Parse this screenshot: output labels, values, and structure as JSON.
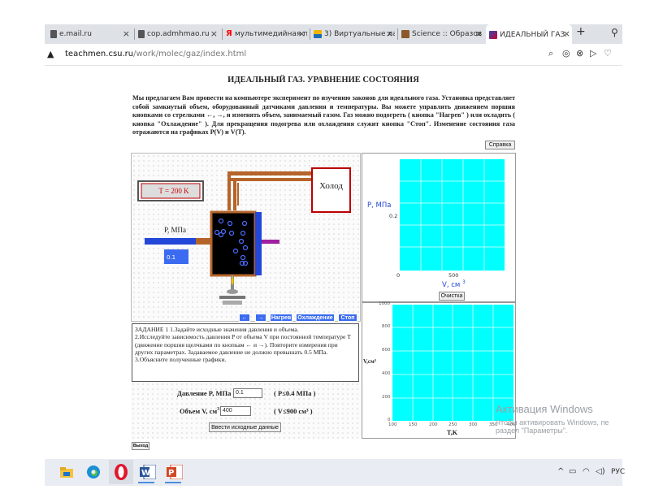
{
  "browser": {
    "tabs": [
      {
        "label": "e.mail.ru",
        "icon": "page-icon"
      },
      {
        "label": "cop.admhmao.ru",
        "icon": "page-icon"
      },
      {
        "label": "мультимедийная п",
        "icon": "yandex-icon"
      },
      {
        "label": "3) Виртуальные ла",
        "icon": "image-icon"
      },
      {
        "label": "Science :: Образов",
        "icon": "science-icon"
      },
      {
        "label": "ИДЕАЛЬНЫЙ ГАЗ.",
        "icon": "lab-icon",
        "active": true
      }
    ],
    "new_tab": "+",
    "close": "×",
    "url_host": "teachmen.csu.ru",
    "url_path": "/work/molec/gaz/index.html"
  },
  "page": {
    "title": "ИДЕАЛЬНЫЙ ГАЗ. УРАВНЕНИЕ СОСТОЯНИЯ",
    "intro": "Мы предлагаем Вам провести на компьютере эксперимент по изучению законов для идеального газа. Установка представляет собой замкнутый объем, оборудованный датчиками давления и температуры. Вы можете управлять движением поршня кнопками со стрелками ←, →, и изменять объем, занимаемый газом. Газ можно подогреть ( кнопка \"Нагрев\" ) или охладить ( кнопка \"Охлаждение\" ). Для прекращения подогрева или охлаждения служит кнопка \"Стоп\". Изменение состояния газа отражаются на графиках P(V) и V(T).",
    "help_button": "Справка"
  },
  "simulation": {
    "temperature": "T = 200 K",
    "cold_label": "Холод",
    "pressure_label": "P, МПа",
    "pressure_value": "0.1",
    "buttons": {
      "left": "←",
      "right": "→",
      "heat": "Нагрев",
      "cool": "Охлаждение",
      "stop": "Стоп"
    }
  },
  "graph_pv": {
    "ylabel": "P, МПа",
    "ytick": "0.2",
    "xtick0": "0",
    "xtick1": "500",
    "xlabel": "V, см",
    "xlabel_sup": "3",
    "clear_button": "Очистка",
    "bg_color": "#00ffff"
  },
  "graph_vt": {
    "ylabel": "V,см³",
    "yticks": [
      "1000",
      "800",
      "600",
      "400",
      "200",
      "0"
    ],
    "xticks": [
      "100",
      "150",
      "200",
      "250",
      "300",
      "350",
      "400"
    ],
    "xlabel": "T,K",
    "bg_color": "#00ffff"
  },
  "task": {
    "text": "ЗАДАНИЕ 1 1.Задайте исходные значения давления и объема.\n2.Исследуйте зависимость давления P от объема V при постоянной температуре T (движение поршня щелчками по кнопкам ← и →). Повторите измерения при других параметрах. Задаваемое давление не должно превышать 0.5 МПа.\n3.Объясните полученные графики."
  },
  "form": {
    "pressure_label": "Давление P, МПа",
    "pressure_value": "0.1",
    "pressure_hint": "( P≤0.4 МПа )",
    "volume_label": "Объем V, см",
    "volume_sup": "3",
    "volume_value": "400",
    "volume_hint": "( V≤900 см³ )",
    "submit": "Ввести исходные данные",
    "exit": "Выход"
  },
  "watermark": {
    "line1": "Активация Windows",
    "line2": "Чтобы активировать Windows, пе",
    "line3": "раздел \"Параметры\"."
  },
  "taskbar": {
    "lang": "РУС",
    "apps": [
      "file-explorer-icon",
      "edge-icon",
      "opera-icon",
      "word-icon",
      "powerpoint-icon"
    ]
  }
}
